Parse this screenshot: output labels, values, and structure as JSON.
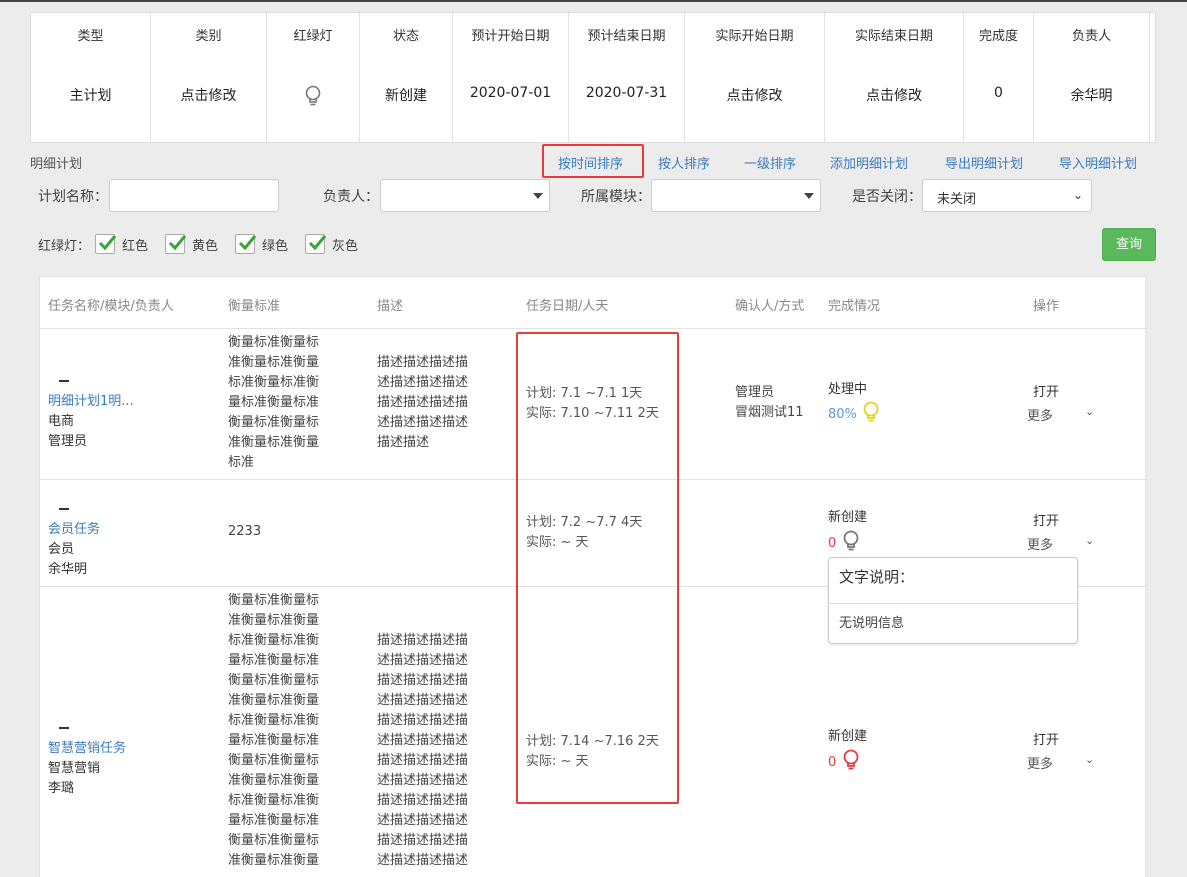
{
  "summary": {
    "columns": [
      {
        "header": "类型",
        "value": "主计划"
      },
      {
        "header": "类别",
        "value": "点击修改"
      },
      {
        "header": "红绿灯",
        "value": ""
      },
      {
        "header": "状态",
        "value": "新创建"
      },
      {
        "header": "预计开始日期",
        "value": "2020-07-01"
      },
      {
        "header": "预计结束日期",
        "value": "2020-07-31"
      },
      {
        "header": "实际开始日期",
        "value": "点击修改"
      },
      {
        "header": "实际结束日期",
        "value": "点击修改"
      },
      {
        "header": "完成度",
        "value": "0"
      },
      {
        "header": "负责人",
        "value": "余华明"
      }
    ]
  },
  "section": {
    "title": "明细计划",
    "actions": [
      "按时间排序",
      "按人排序",
      "一级排序",
      "添加明细计划",
      "导出明细计划",
      "导入明细计划"
    ]
  },
  "filters": {
    "plan_name_label": "计划名称：",
    "owner_label": "负责人：",
    "module_label": "所属模块：",
    "closed_label": "是否关闭：",
    "closed_value": "未关闭",
    "light_label": "红绿灯：",
    "lights": [
      "红色",
      "黄色",
      "绿色",
      "灰色"
    ],
    "query": "查询"
  },
  "table": {
    "headers": [
      "任务名称/模块/负责人",
      "衡量标准",
      "描述",
      "任务日期/人天",
      "确认人/方式",
      "完成情况",
      "操作"
    ],
    "rows": [
      {
        "name": "明细计划1明...",
        "module": "电商",
        "owner": "管理员",
        "standard": [
          "衡量标准衡量标",
          "准衡量标准衡量",
          "标准衡量标准衡",
          "量标准衡量标准",
          "衡量标准衡量标",
          "准衡量标准衡量",
          "标准"
        ],
        "desc": [
          "描述描述描述描",
          "述描述描述描述",
          "描述描述描述描",
          "述描述描述描述",
          "描述描述"
        ],
        "plan": "计划: 7.1 ~7.1    1天",
        "actual": "实际: 7.10 ~7.11    2天",
        "confirm": [
          "管理员",
          "冒烟测试11"
        ],
        "status": "处理中",
        "percent": "80%",
        "bulb_color": "#e8d11a",
        "percent_color": "#5b9bd5",
        "open": "打开",
        "more": "更多"
      },
      {
        "name": "会员任务",
        "module": "会员",
        "owner": "余华明",
        "standard": [
          "2233"
        ],
        "desc": [],
        "plan": "计划: 7.2 ~7.7    4天",
        "actual": "实际: ~     天",
        "confirm": [],
        "status": "新创建",
        "percent": "0",
        "bulb_color": "#777777",
        "percent_color": "#e53b3b",
        "open": "打开",
        "more": "更多"
      },
      {
        "name": "智慧营销任务",
        "module": "智慧营销",
        "owner": "李璐",
        "standard": [
          "衡量标准衡量标",
          "准衡量标准衡量",
          "标准衡量标准衡",
          "量标准衡量标准",
          "衡量标准衡量标",
          "准衡量标准衡量",
          "标准衡量标准衡",
          "量标准衡量标准",
          "衡量标准衡量标",
          "准衡量标准衡量",
          "标准衡量标准衡",
          "量标准衡量标准",
          "衡量标准衡量标",
          "准衡量标准衡量"
        ],
        "desc": [
          "描述描述描述描",
          "述描述描述描述",
          "描述描述描述描",
          "述描述描述描述",
          "描述描述描述描",
          "述描述描述描述",
          "描述描述描述描",
          "述描述描述描述",
          "描述描述描述描",
          "述描述描述描述",
          "描述描述描述描",
          "述描述描述描述"
        ],
        "plan": "计划: 7.14 ~7.16    2天",
        "actual": "实际: ~     天",
        "confirm": [],
        "status": "新创建",
        "percent": "0",
        "bulb_color": "#e53b3b",
        "percent_color": "#e53b3b",
        "open": "打开",
        "more": "更多"
      }
    ]
  },
  "tooltip": {
    "title": "文字说明：",
    "body": "无说明信息"
  }
}
